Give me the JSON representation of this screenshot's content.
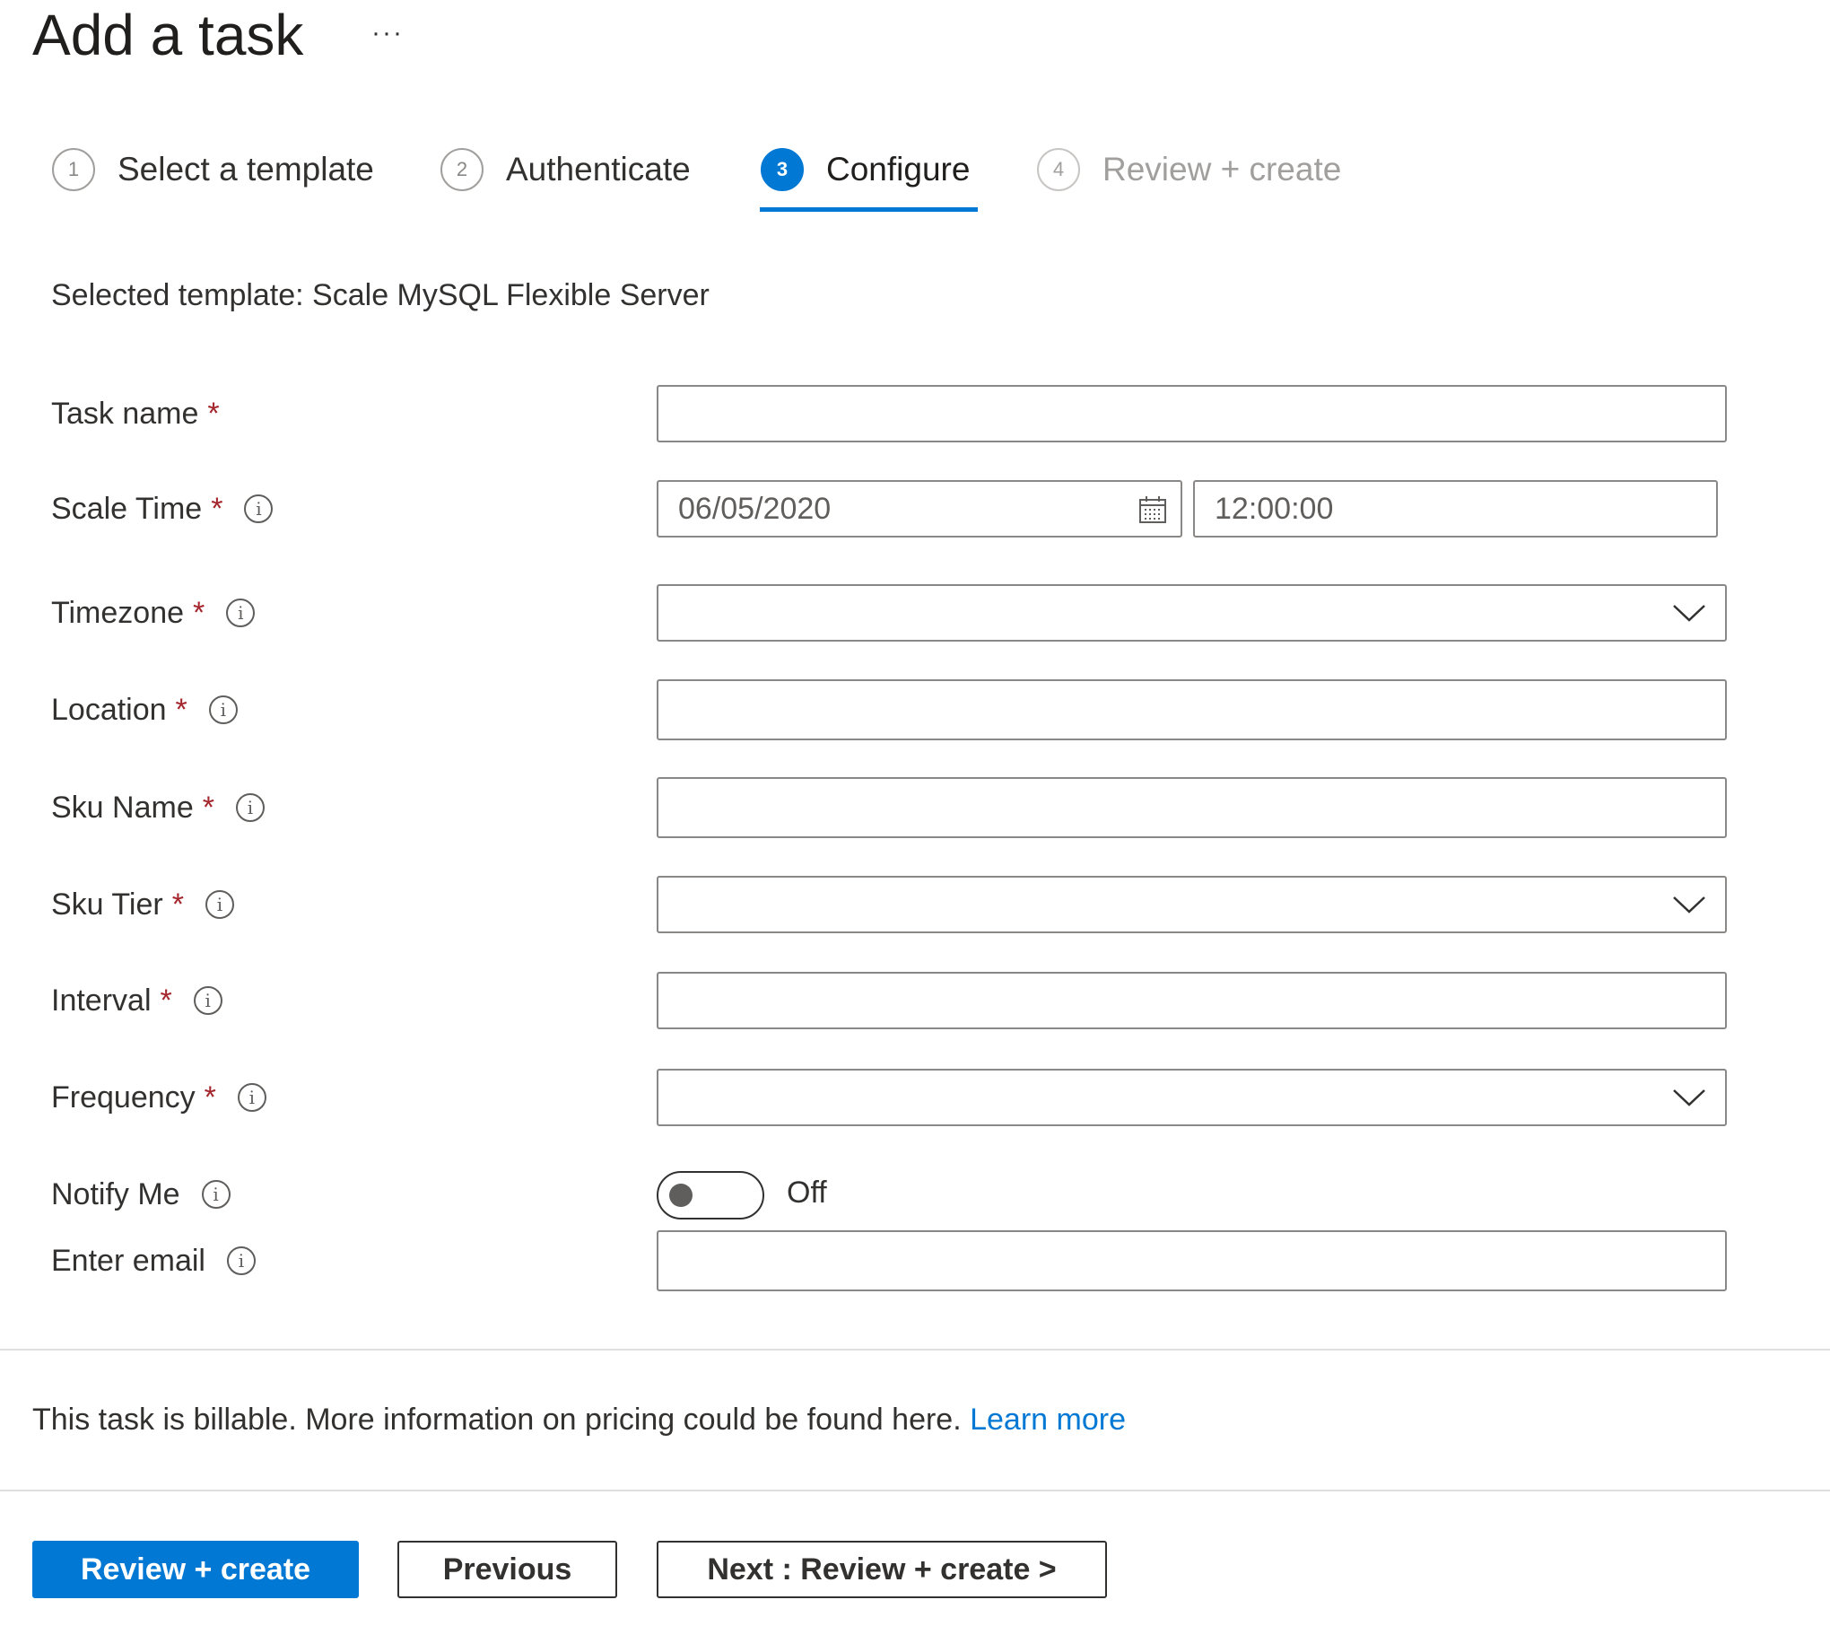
{
  "header": {
    "title": "Add a task",
    "more_icon": "ellipsis-icon",
    "more_label": "···"
  },
  "stepper": {
    "steps": [
      {
        "number": "1",
        "label": "Select a template",
        "state": "completed"
      },
      {
        "number": "2",
        "label": "Authenticate",
        "state": "completed"
      },
      {
        "number": "3",
        "label": "Configure",
        "state": "active"
      },
      {
        "number": "4",
        "label": "Review + create",
        "state": "disabled"
      }
    ],
    "active_color": "#0078d4"
  },
  "selected_template": "Selected template: Scale MySQL Flexible Server",
  "form": {
    "required_marker": "*",
    "info_glyph": "i",
    "fields": {
      "task_name": {
        "label": "Task name",
        "value": "",
        "required": true,
        "info": false
      },
      "scale_time": {
        "label": "Scale Time",
        "date_value": "06/05/2020",
        "time_value": "12:00:00",
        "required": true,
        "info": true
      },
      "timezone": {
        "label": "Timezone",
        "value": "",
        "type": "dropdown",
        "required": true,
        "info": true
      },
      "location": {
        "label": "Location",
        "value": "",
        "required": true,
        "info": true
      },
      "sku_name": {
        "label": "Sku Name",
        "value": "",
        "required": true,
        "info": true
      },
      "sku_tier": {
        "label": "Sku Tier",
        "value": "",
        "type": "dropdown",
        "required": true,
        "info": true
      },
      "interval": {
        "label": "Interval",
        "value": "",
        "required": true,
        "info": true
      },
      "frequency": {
        "label": "Frequency",
        "value": "",
        "type": "dropdown",
        "required": true,
        "info": true
      },
      "notify_me": {
        "label": "Notify Me",
        "state": "Off",
        "on": false,
        "info": true
      },
      "email": {
        "label": "Enter email",
        "value": "",
        "info": true
      }
    }
  },
  "billing": {
    "text": "This task is billable. More information on pricing could be found here. ",
    "link": "Learn more",
    "link_color": "#0078d4"
  },
  "footer": {
    "primary": "Review + create",
    "previous": "Previous",
    "next": "Next : Review + create >"
  }
}
